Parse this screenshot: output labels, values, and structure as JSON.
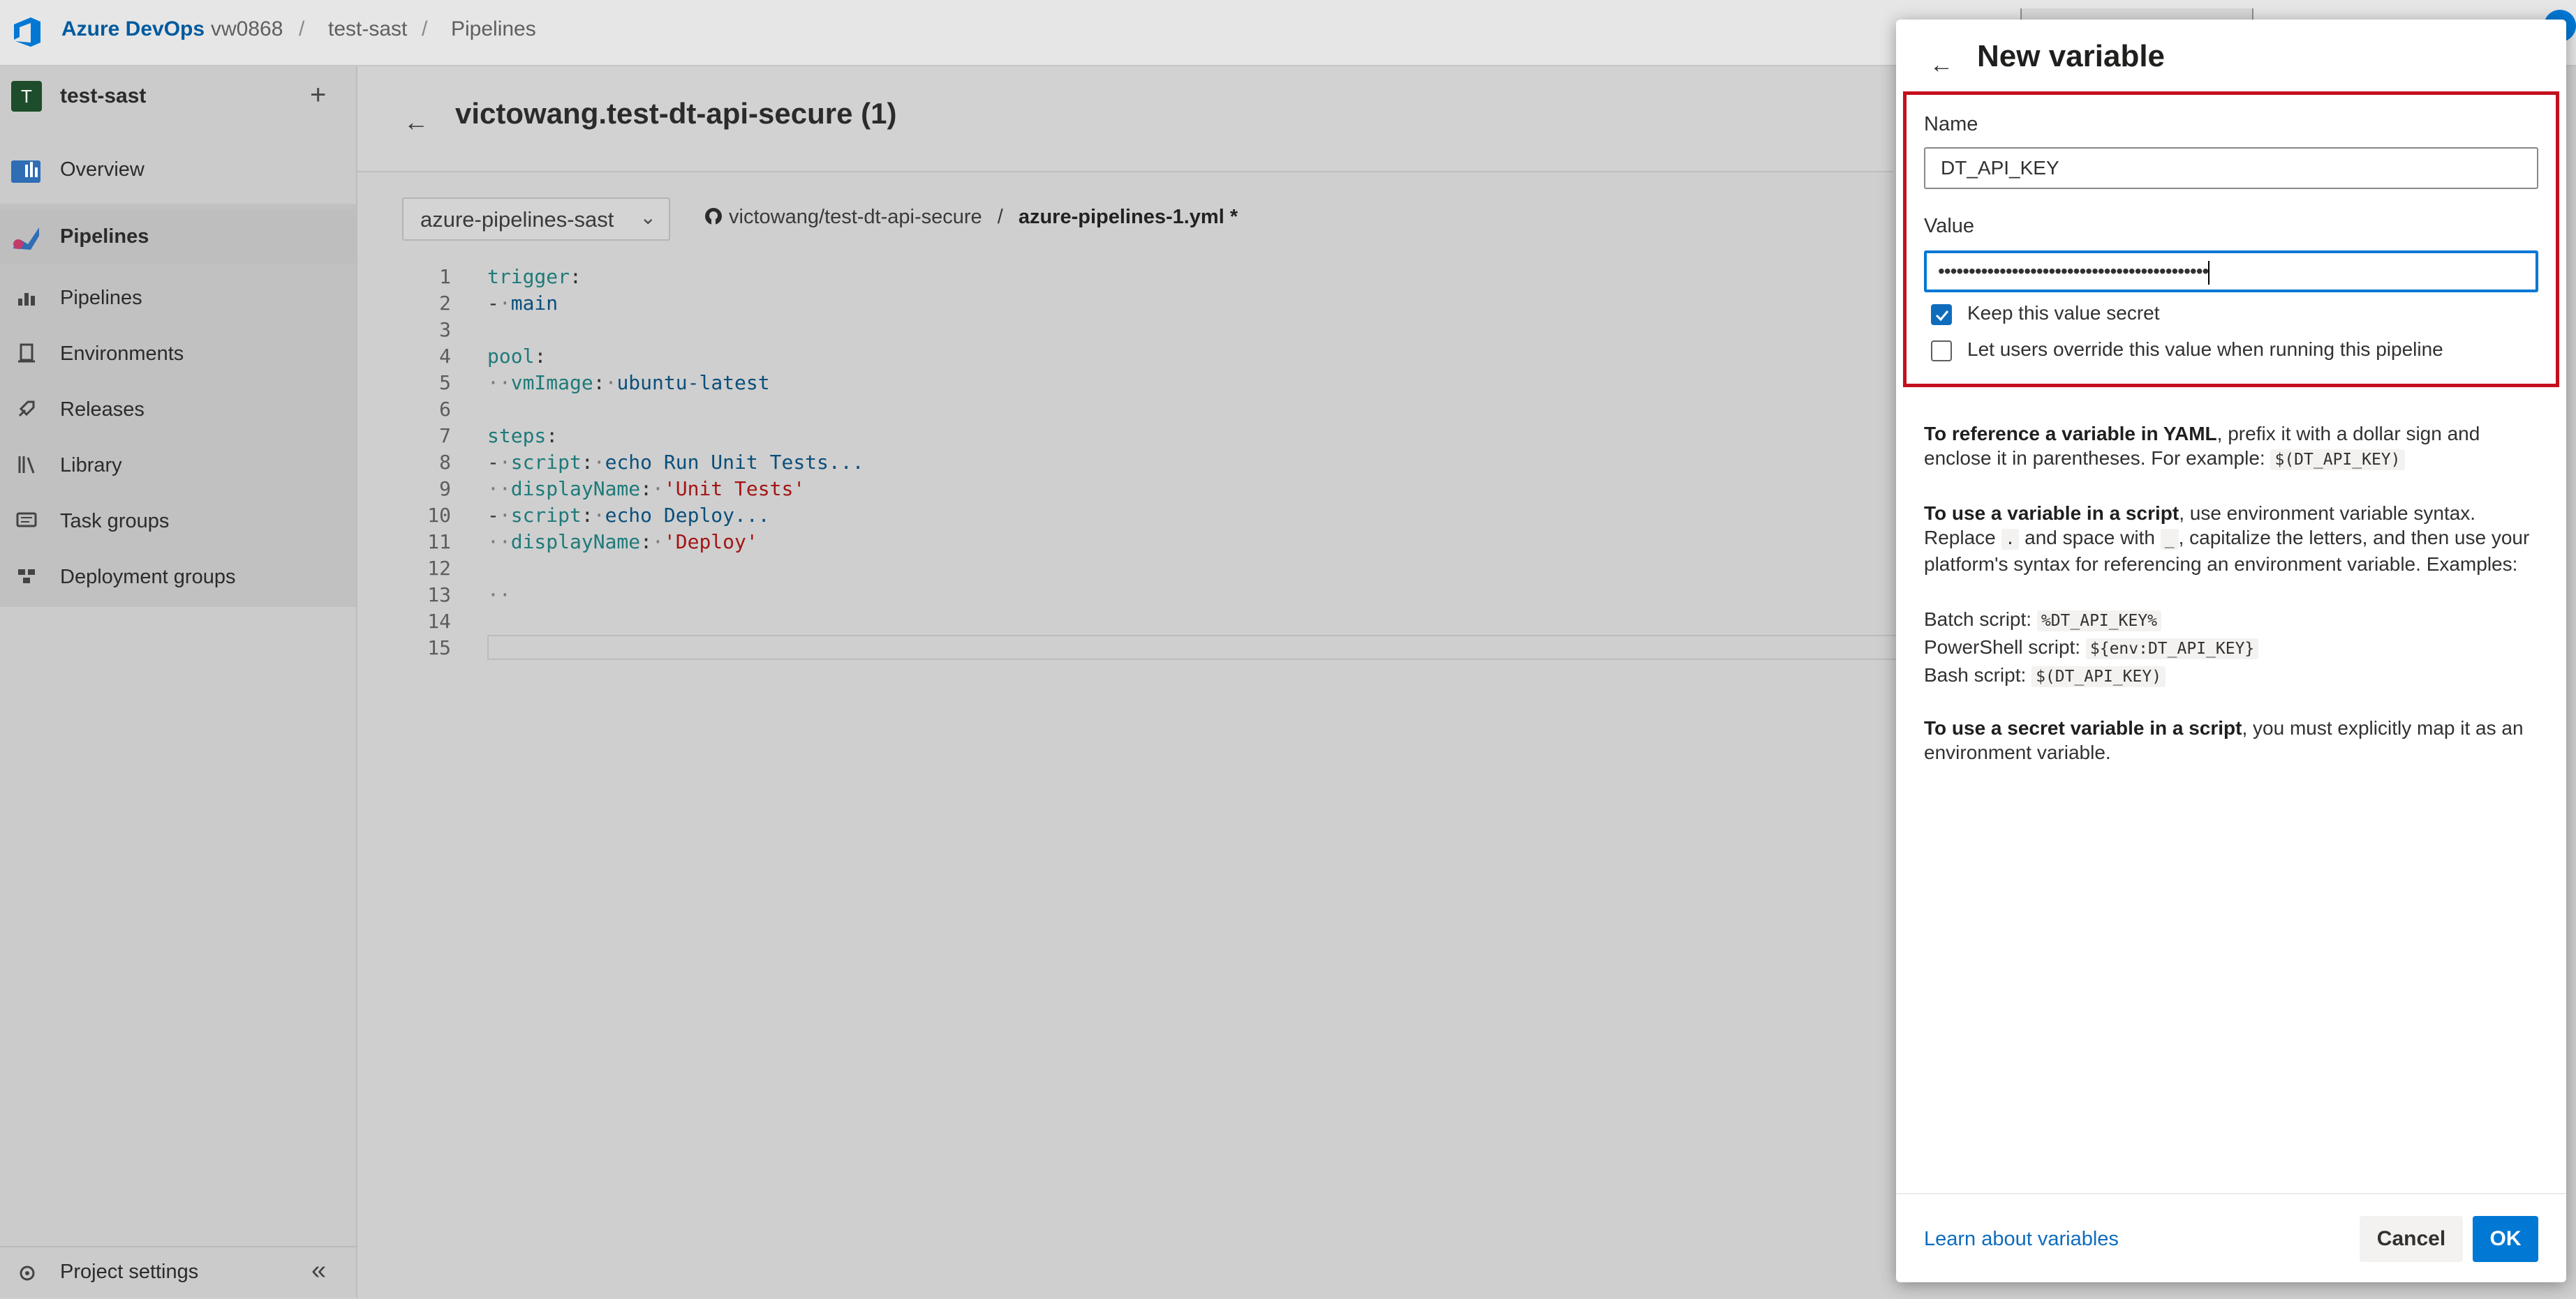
{
  "topbar": {
    "brand": "Azure DevOps",
    "org": "vw0868",
    "project": "test-sast",
    "section": "Pipelines",
    "separator": "/"
  },
  "sidebar": {
    "project_initial": "T",
    "project_name": "test-sast",
    "add": "+",
    "items": [
      {
        "label": "Overview",
        "icon": "overview-icon"
      },
      {
        "label": "Pipelines",
        "icon": "pipelines-icon"
      },
      {
        "label": "Pipelines",
        "icon": "pipelines-sub-icon"
      },
      {
        "label": "Environments",
        "icon": "environments-icon"
      },
      {
        "label": "Releases",
        "icon": "releases-icon"
      },
      {
        "label": "Library",
        "icon": "library-icon"
      },
      {
        "label": "Task groups",
        "icon": "task-groups-icon"
      },
      {
        "label": "Deployment groups",
        "icon": "deployment-groups-icon"
      }
    ],
    "settings_label": "Project settings",
    "collapse": "«"
  },
  "main": {
    "back": "←",
    "title": "victowang.test-dt-api-secure (1)",
    "branch": "azure-pipelines-sast",
    "repo": "victowang/test-dt-api-secure",
    "path_sep": "/",
    "file": "azure-pipelines-1.yml *"
  },
  "code": {
    "l1_key": "trigger",
    "l2_val": "main",
    "l4_key": "pool",
    "l5_key": "vmImage",
    "l5_val": "ubuntu-latest",
    "l7_key": "steps",
    "l8_key": "script",
    "l8_val": "echo Run Unit Tests...",
    "l9_key": "displayName",
    "l9_val": "'Unit Tests'",
    "l10_key": "script",
    "l10_val": "echo Deploy...",
    "l11_key": "displayName",
    "l11_val": "'Deploy'"
  },
  "panel": {
    "back": "←",
    "title": "New variable",
    "name_label": "Name",
    "name_value": "DT_API_KEY",
    "value_label": "Value",
    "value_masked": "••••••••••••••••••••••••••••••••••••••••••••",
    "secret_label": "Keep this value secret",
    "secret_checked": true,
    "override_label": "Let users override this value when running this pipeline",
    "override_checked": false,
    "help": {
      "yaml_bold": "To reference a variable in YAML",
      "yaml_rest": ", prefix it with a dollar sign and enclose it in parentheses. For example: ",
      "yaml_code": "$(DT_API_KEY)",
      "script_bold": "To use a variable in a script",
      "script_rest1": ", use environment variable syntax. Replace ",
      "script_code1": ".",
      "script_rest2": " and space with ",
      "script_code2": "_",
      "script_rest3": ", capitalize the letters, and then use your platform's syntax for referencing an environment variable. Examples:",
      "batch_label": "Batch script: ",
      "batch_code": "%DT_API_KEY%",
      "ps_label": "PowerShell script: ",
      "ps_code": "${env:DT_API_KEY}",
      "bash_label": "Bash script: ",
      "bash_code": "$(DT_API_KEY)",
      "secret_bold": "To use a secret variable in a script",
      "secret_rest": ", you must explicitly map it as an environment variable."
    },
    "learn_link": "Learn about variables",
    "cancel": "Cancel",
    "ok": "OK"
  },
  "colors": {
    "accent": "#0078d4",
    "highlight_border": "#c50f1f",
    "brand_text": "#005a9e"
  }
}
